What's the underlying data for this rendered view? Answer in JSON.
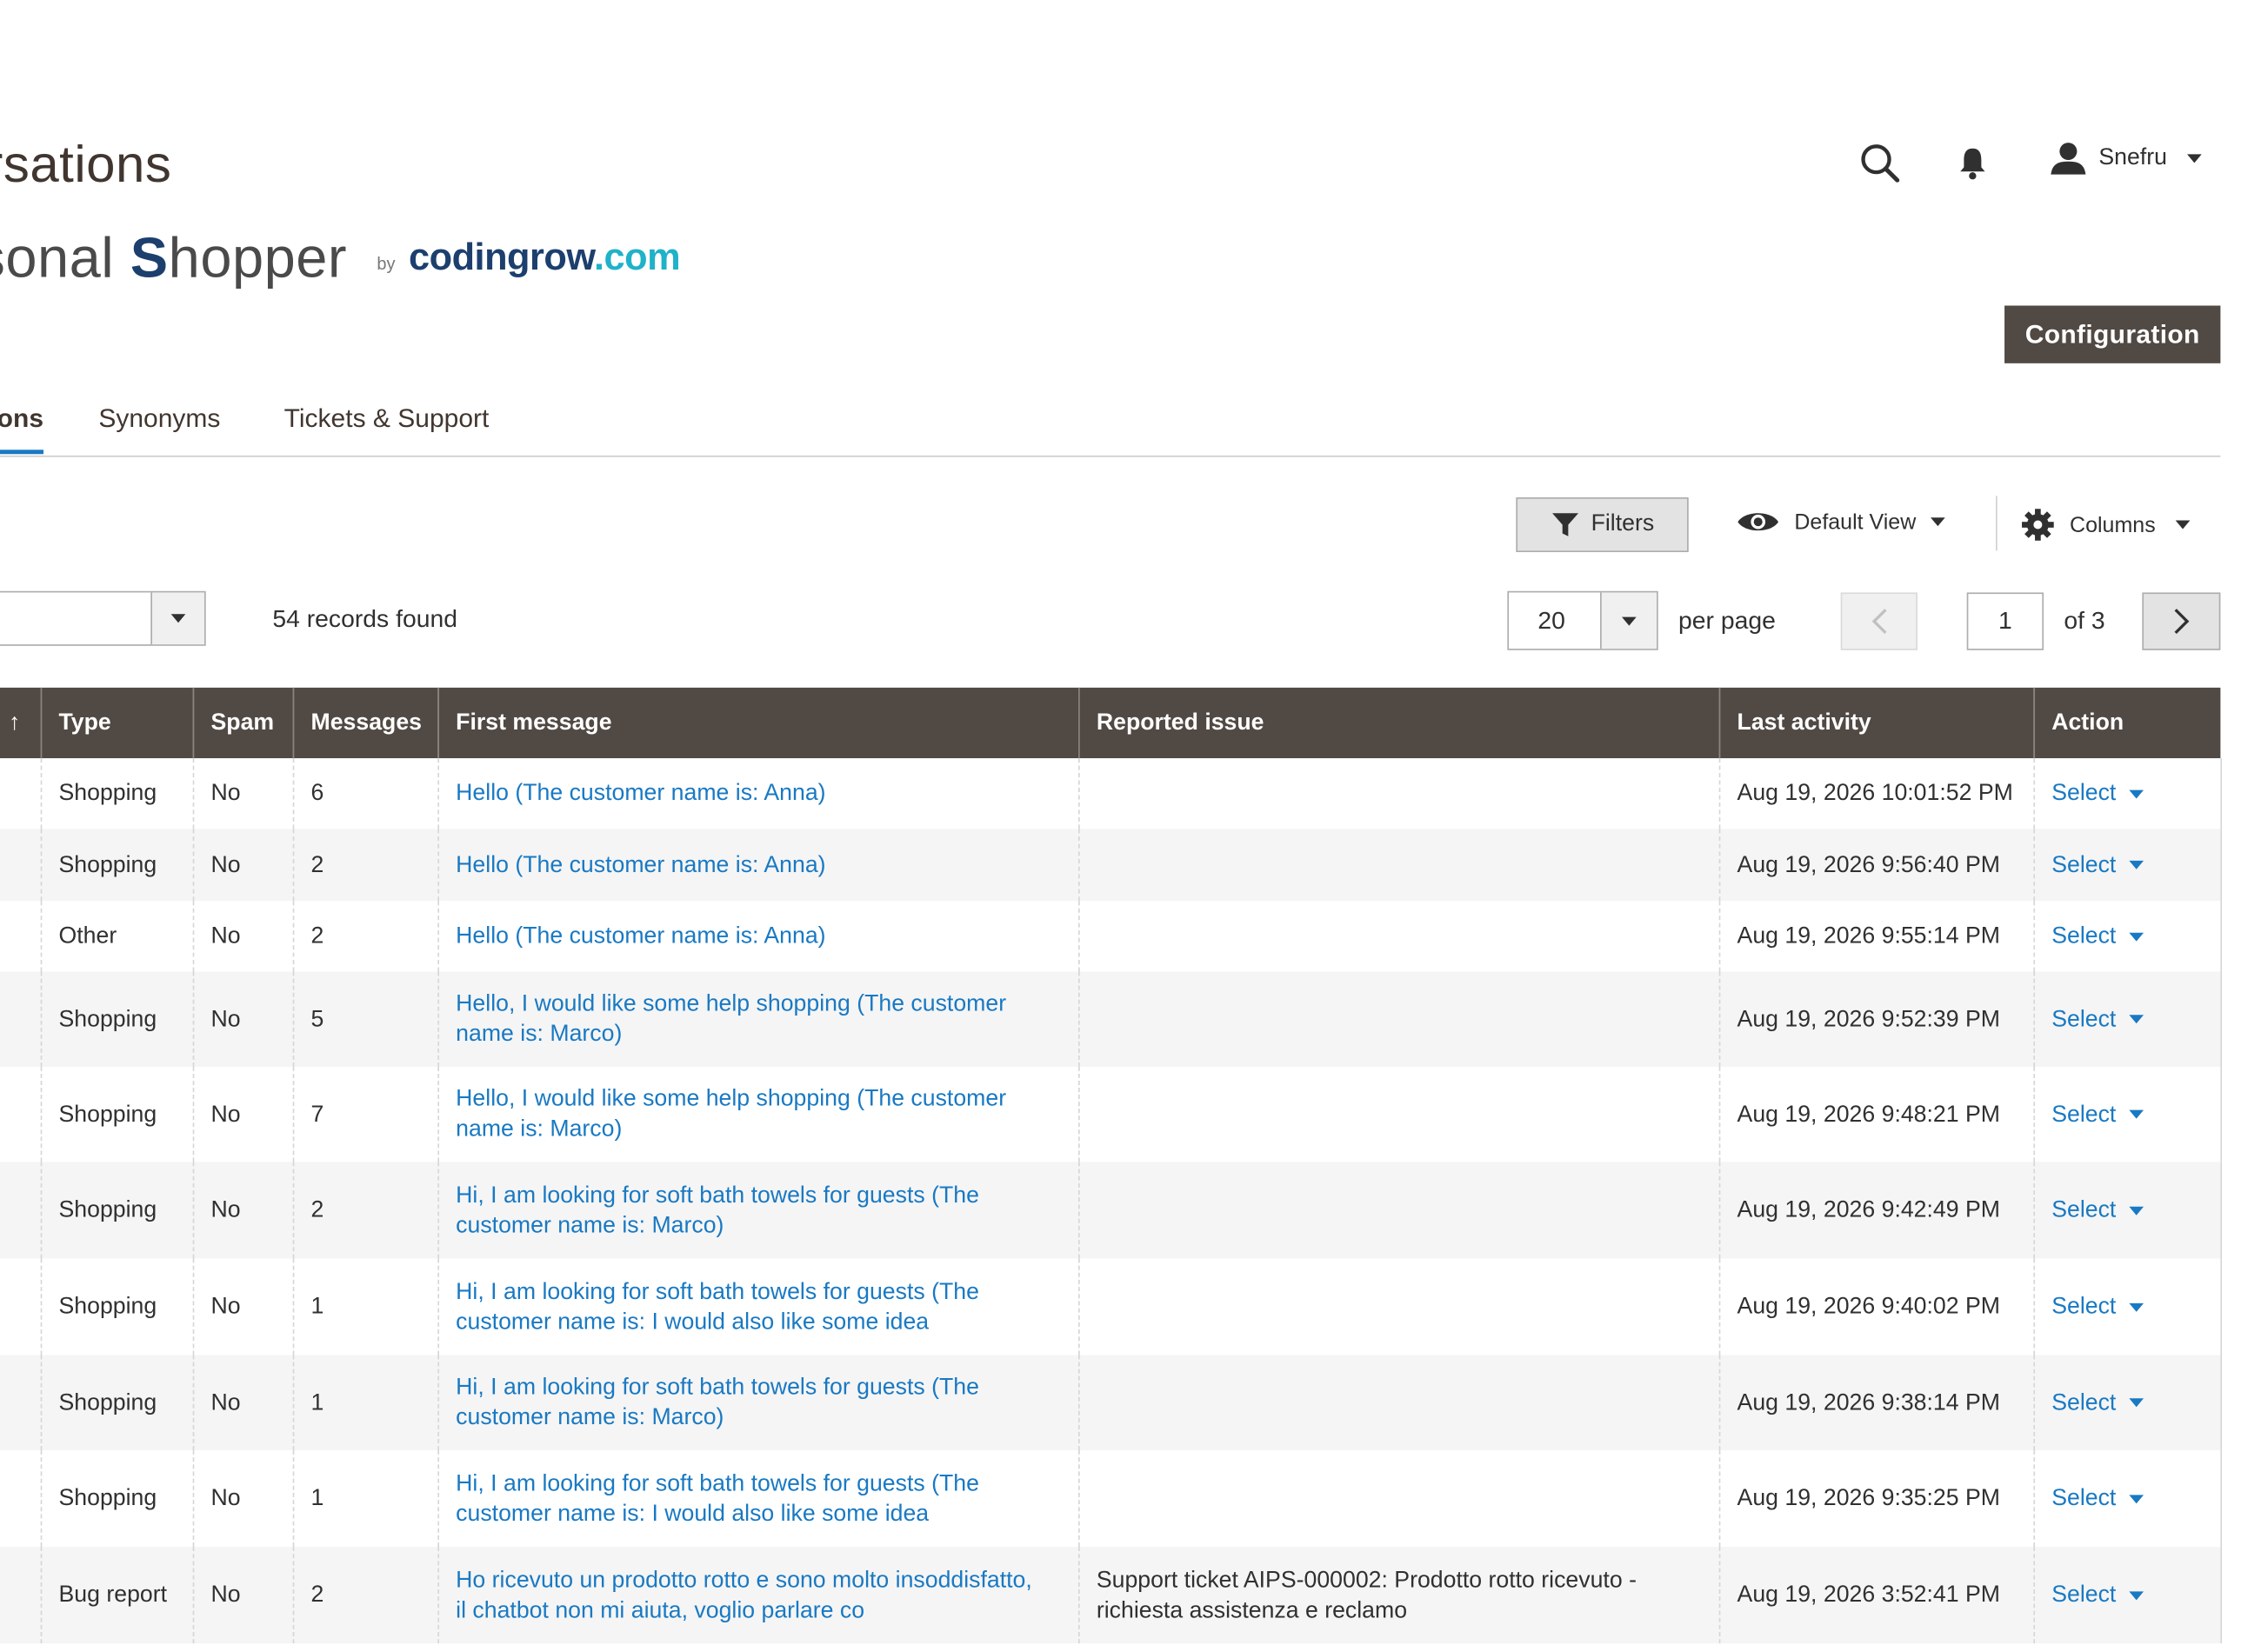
{
  "header": {
    "page_title": "rsations",
    "brand": {
      "part1": "sonal ",
      "s_letter": "S",
      "part2": "hopper",
      "by": "by",
      "logo_a": "codingrow",
      "logo_b": ".com"
    },
    "username": "Snefru",
    "icons": [
      "search-icon",
      "bell-icon",
      "user-icon"
    ],
    "configuration_label": "Configuration"
  },
  "tabs": [
    {
      "label": "ons",
      "active": true
    },
    {
      "label": "Synonyms",
      "active": false
    },
    {
      "label": "Tickets & Support",
      "active": false
    }
  ],
  "toolbar": {
    "filters_label": "Filters",
    "view_label": "Default View",
    "columns_label": "Columns",
    "records_found": "54 records found",
    "per_page_value": "20",
    "per_page_label": "per page",
    "page_value": "1",
    "page_of": "of 3"
  },
  "colors": {
    "header_bg": "#514943",
    "link": "#1979c3",
    "accent_logo": "#1fb2c8",
    "button_dark": "#514943"
  },
  "grid": {
    "columns": [
      "↑",
      "Type",
      "Spam",
      "Messages",
      "First message",
      "Reported issue",
      "Last activity",
      "Action"
    ],
    "rows": [
      {
        "type": "Shopping",
        "spam": "No",
        "messages": "6",
        "first": "Hello (The customer name is: Anna)",
        "issue": "",
        "last": "Aug 19, 2026 10:01:52 PM",
        "action": "Select"
      },
      {
        "type": "Shopping",
        "spam": "No",
        "messages": "2",
        "first": "Hello (The customer name is: Anna)",
        "issue": "",
        "last": "Aug 19, 2026 9:56:40 PM",
        "action": "Select"
      },
      {
        "type": "Other",
        "spam": "No",
        "messages": "2",
        "first": "Hello (The customer name is: Anna)",
        "issue": "",
        "last": "Aug 19, 2026 9:55:14 PM",
        "action": "Select"
      },
      {
        "type": "Shopping",
        "spam": "No",
        "messages": "5",
        "first": "Hello, I would like some help shopping (The customer name is: Marco)",
        "issue": "",
        "last": "Aug 19, 2026 9:52:39 PM",
        "action": "Select"
      },
      {
        "type": "Shopping",
        "spam": "No",
        "messages": "7",
        "first": "Hello, I would like some help shopping (The customer name is: Marco)",
        "issue": "",
        "last": "Aug 19, 2026 9:48:21 PM",
        "action": "Select"
      },
      {
        "type": "Shopping",
        "spam": "No",
        "messages": "2",
        "first": "Hi, I am looking for soft bath towels for guests (The customer name is: Marco)",
        "issue": "",
        "last": "Aug 19, 2026 9:42:49 PM",
        "action": "Select"
      },
      {
        "type": "Shopping",
        "spam": "No",
        "messages": "1",
        "first": "Hi, I am looking for soft bath towels for guests (The customer name is: I would also like some idea",
        "issue": "",
        "last": "Aug 19, 2026 9:40:02 PM",
        "action": "Select"
      },
      {
        "type": "Shopping",
        "spam": "No",
        "messages": "1",
        "first": "Hi, I am looking for soft bath towels for guests (The customer name is: Marco)",
        "issue": "",
        "last": "Aug 19, 2026 9:38:14 PM",
        "action": "Select"
      },
      {
        "type": "Shopping",
        "spam": "No",
        "messages": "1",
        "first": "Hi, I am looking for soft bath towels for guests (The customer name is: I would also like some idea",
        "issue": "",
        "last": "Aug 19, 2026 9:35:25 PM",
        "action": "Select"
      },
      {
        "type": "Bug report",
        "spam": "No",
        "messages": "2",
        "first": "Ho ricevuto un prodotto rotto e sono molto insoddisfatto, il chatbot non mi aiuta, voglio parlare co",
        "issue": "Support ticket AIPS-000002: Prodotto rotto ricevuto - richiesta assistenza e reclamo",
        "last": "Aug 19, 2026 3:52:41 PM",
        "action": "Select"
      }
    ]
  }
}
